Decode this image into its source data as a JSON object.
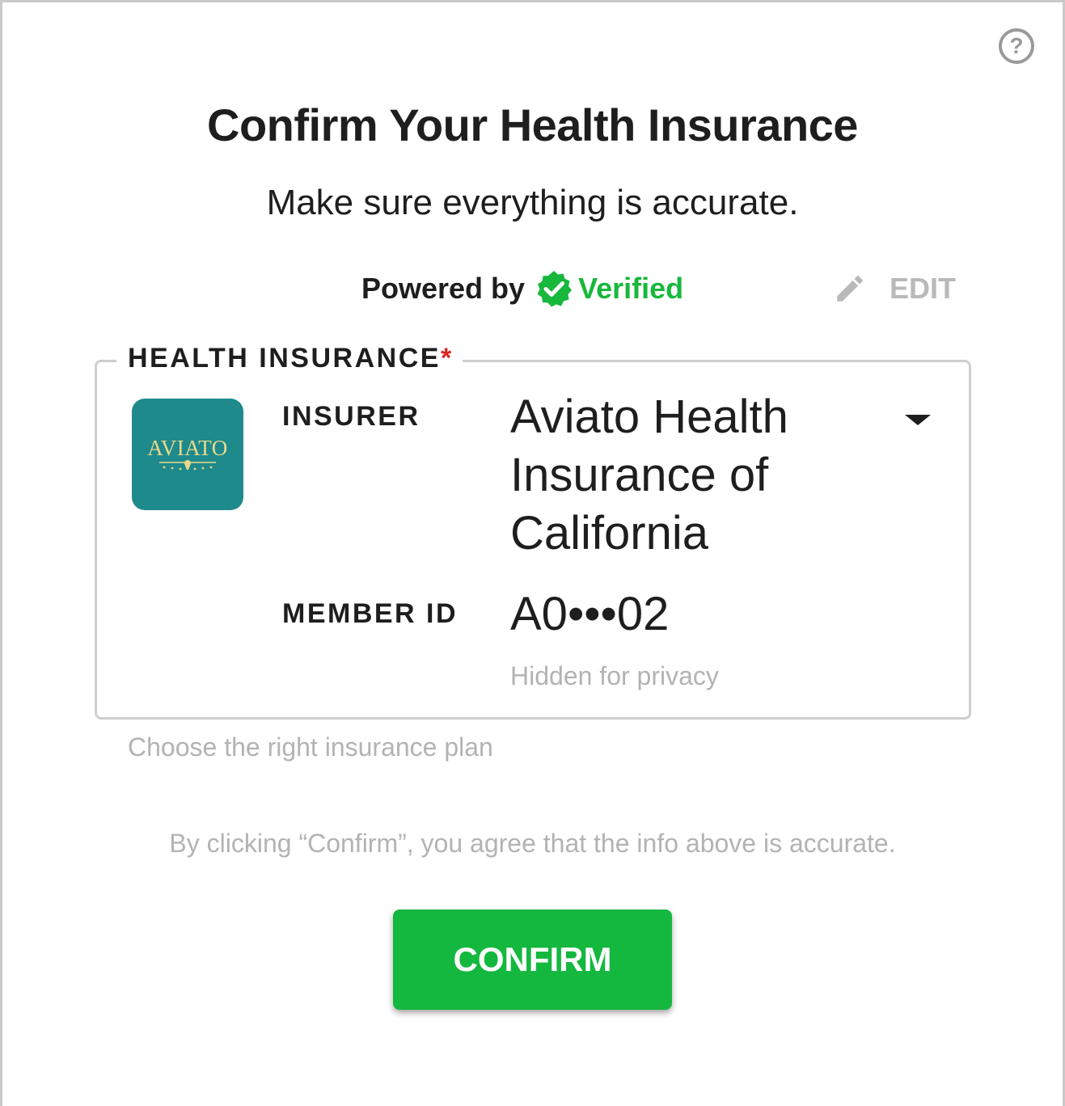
{
  "header": {
    "title": "Confirm Your Health Insurance",
    "subtitle": "Make sure everything is accurate."
  },
  "powered_by": {
    "label": "Powered by",
    "brand": "Verified",
    "brand_color": "#17b83c"
  },
  "edit": {
    "label": "EDIT",
    "icon": "pencil-icon"
  },
  "help": {
    "glyph": "?",
    "icon": "help-icon"
  },
  "insurance": {
    "section_label": "HEALTH INSURANCE",
    "required_mark": "*",
    "logo_text": "AVIATO",
    "insurer_label": "INSURER",
    "insurer_value": "Aviato Health Insurance of California",
    "member_label": "MEMBER ID",
    "member_value": "A0•••02",
    "member_hint": "Hidden for privacy",
    "helper_text": "Choose the right insurance plan"
  },
  "footer": {
    "agreement": "By clicking “Confirm”, you agree that the info above is accurate.",
    "confirm_label": "CONFIRM",
    "confirm_color": "#14b83e"
  }
}
